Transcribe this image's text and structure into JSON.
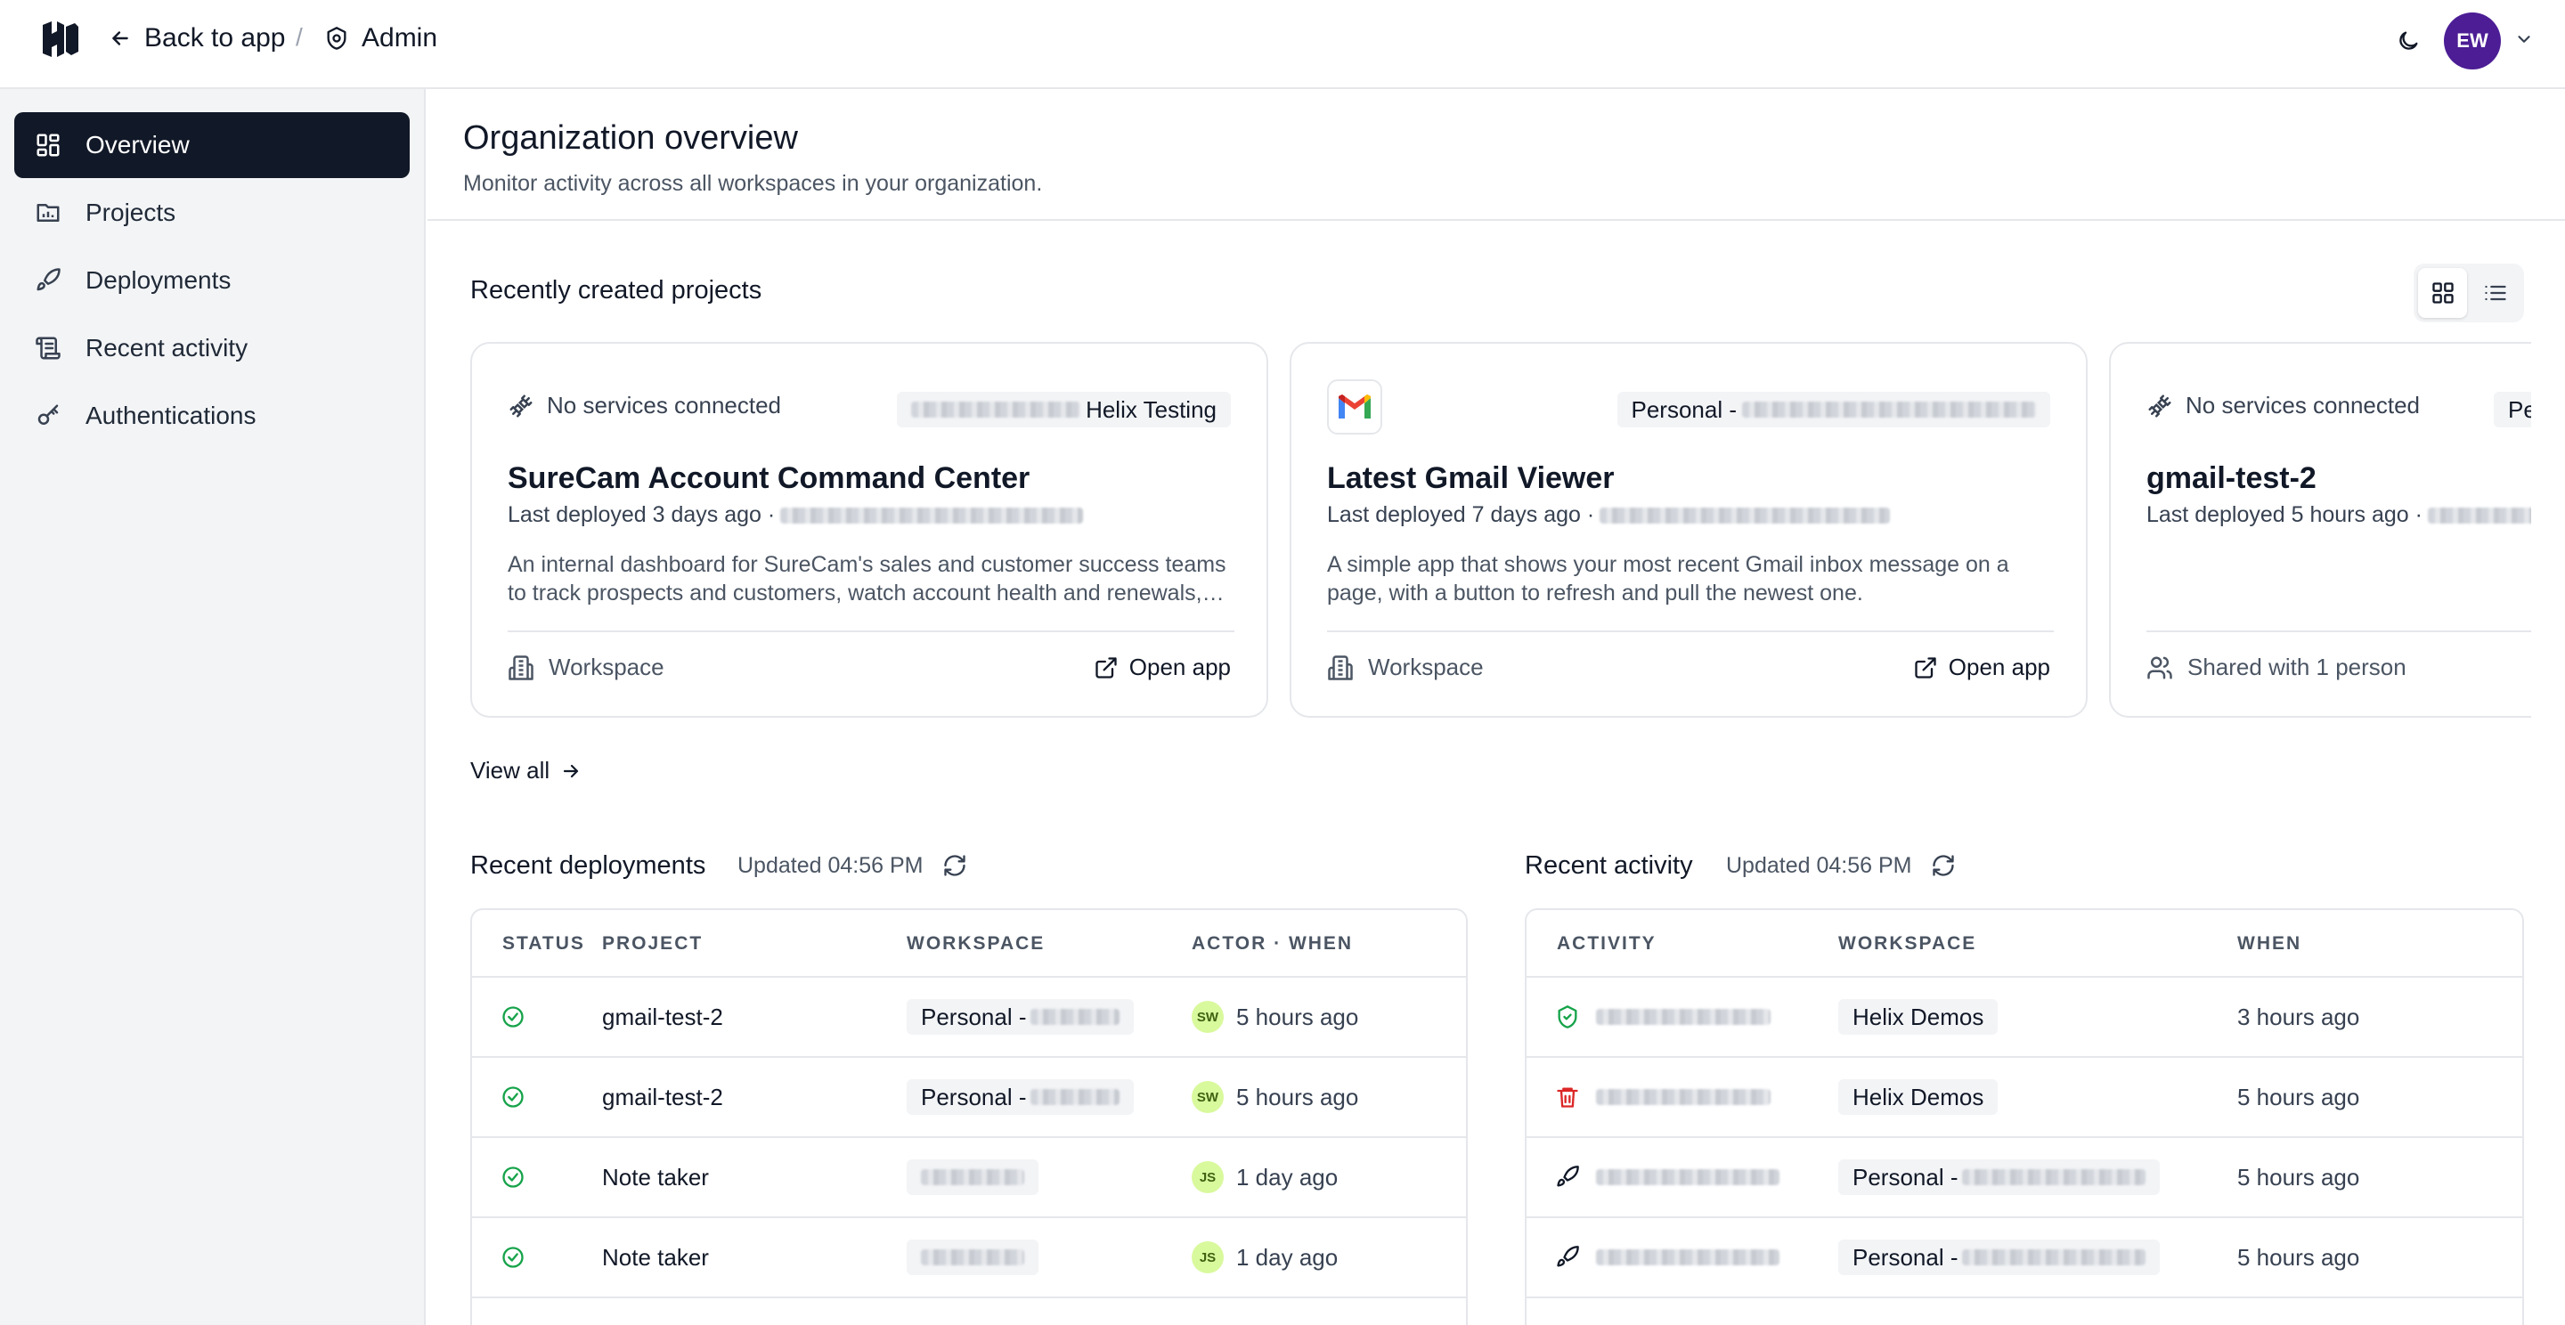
{
  "header": {
    "back_label": "Back to app",
    "separator": "/",
    "admin_label": "Admin",
    "avatar_initials": "EW",
    "avatar_color": "#4c1d95"
  },
  "sidebar": {
    "items": [
      {
        "label": "Overview",
        "icon": "grid-icon",
        "active": true
      },
      {
        "label": "Projects",
        "icon": "folder-chart-icon"
      },
      {
        "label": "Deployments",
        "icon": "rocket-icon"
      },
      {
        "label": "Recent activity",
        "icon": "scroll-icon"
      },
      {
        "label": "Authentications",
        "icon": "key-icon"
      }
    ]
  },
  "page": {
    "title": "Organization overview",
    "subtitle": "Monitor activity across all workspaces in your organization."
  },
  "projects": {
    "title": "Recently created projects",
    "view_all": "View all",
    "cards": [
      {
        "services": "No services connected",
        "workspace": "Helix Testing",
        "title": "SureCam Account Command Center",
        "deployed": "Last deployed 3 days ago ·",
        "description": "An internal dashboard for SureCam's sales and customer success teams to track prospects and customers, watch account health and renewals, and manage follow-ups.",
        "footer_left": "Workspace",
        "footer_right": "Open app"
      },
      {
        "services": "",
        "workspace": "Personal -",
        "title": "Latest Gmail Viewer",
        "deployed": "Last deployed 7 days ago ·",
        "description": "A simple app that shows your most recent Gmail inbox message on a page, with a button to refresh and pull the newest one.",
        "footer_left": "Workspace",
        "footer_right": "Open app"
      },
      {
        "services": "No services connected",
        "workspace": "Pe",
        "title": "gmail-test-2",
        "deployed": "Last deployed 5 hours ago ·",
        "description": "",
        "footer_left": "Shared with 1 person",
        "footer_right": ""
      }
    ]
  },
  "deployments": {
    "title": "Recent deployments",
    "updated": "Updated 04:56 PM",
    "columns": [
      "STATUS",
      "PROJECT",
      "WORKSPACE",
      "ACTOR · WHEN"
    ],
    "rows": [
      {
        "project": "gmail-test-2",
        "workspace": "Personal -",
        "actor": "SW",
        "when": "5 hours ago"
      },
      {
        "project": "gmail-test-2",
        "workspace": "Personal -",
        "actor": "SW",
        "when": "5 hours ago"
      },
      {
        "project": "Note taker",
        "workspace": "",
        "actor": "JS",
        "when": "1 day ago"
      },
      {
        "project": "Note taker",
        "workspace": "",
        "actor": "JS",
        "when": "1 day ago"
      }
    ]
  },
  "activity": {
    "title": "Recent activity",
    "updated": "Updated 04:56 PM",
    "columns": [
      "ACTIVITY",
      "WORKSPACE",
      "WHEN"
    ],
    "rows": [
      {
        "icon": "shield-check-icon",
        "workspace": "Helix Demos",
        "when": "3 hours ago"
      },
      {
        "icon": "trash-icon",
        "workspace": "Helix Demos",
        "when": "5 hours ago"
      },
      {
        "icon": "rocket-icon",
        "workspace": "Personal -",
        "when": "5 hours ago"
      },
      {
        "icon": "rocket-icon",
        "workspace": "Personal -",
        "when": "5 hours ago"
      }
    ]
  },
  "colors": {
    "success": "#16a34a",
    "danger": "#dc2626",
    "active_nav": "#111827"
  }
}
